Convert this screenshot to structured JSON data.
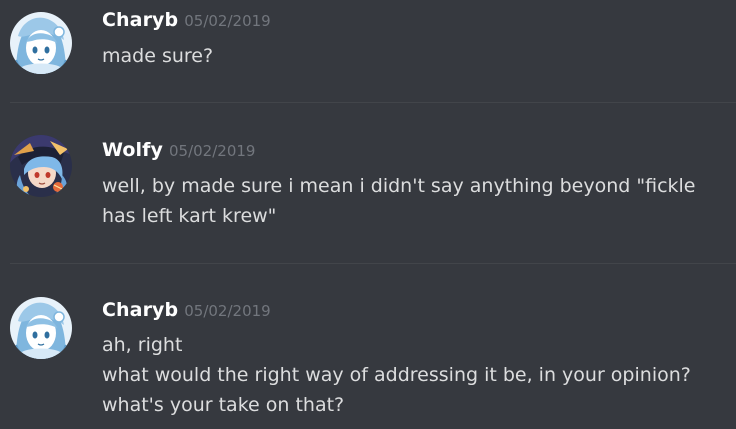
{
  "messages": [
    {
      "author": "Charyb",
      "timestamp": "05/02/2019",
      "avatar_icon": "girl-avatar-icon",
      "lines": [
        "made sure?"
      ]
    },
    {
      "author": "Wolfy",
      "timestamp": "05/02/2019",
      "avatar_icon": "anime-character-avatar-icon",
      "lines": [
        "well, by made sure i mean i didn't say anything beyond \"fickle",
        "has left kart krew\""
      ]
    },
    {
      "author": "Charyb",
      "timestamp": "05/02/2019",
      "avatar_icon": "girl-avatar-icon",
      "lines": [
        "ah, right",
        "what would the right way of addressing it be, in your opinion?",
        "what's your take on that?"
      ]
    }
  ],
  "colors": {
    "background": "#36393f",
    "username": "#ffffff",
    "timestamp": "#72767d",
    "text": "#dcddde",
    "divider": "#42454a"
  }
}
